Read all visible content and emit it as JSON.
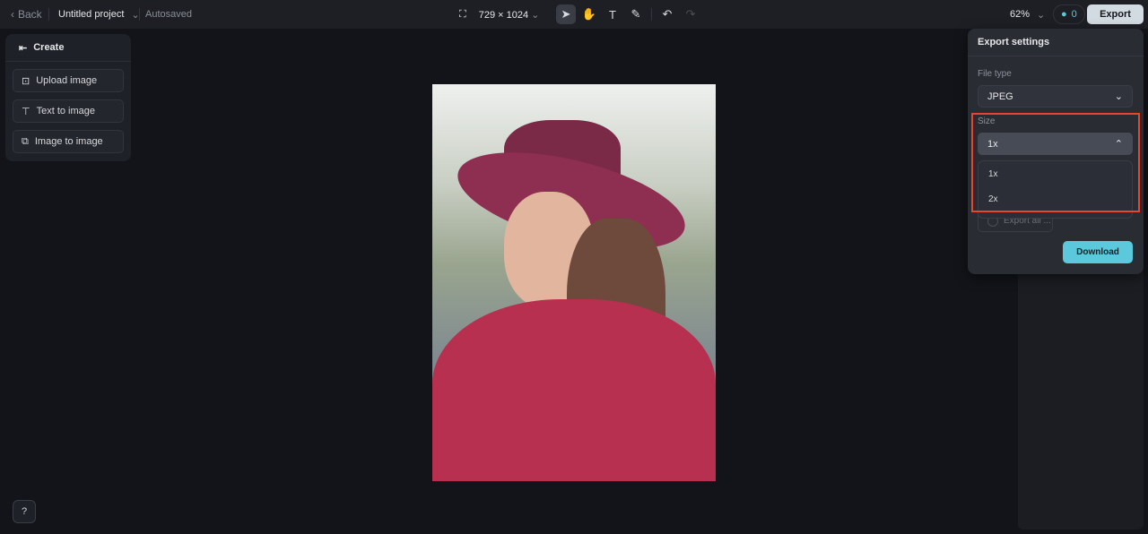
{
  "topbar": {
    "back": "Back",
    "project": "Untitled project",
    "status": "Autosaved",
    "dimensions": "729 × 1024",
    "zoom": "62%",
    "credits": "0",
    "export": "Export"
  },
  "create": {
    "title": "Create",
    "items": [
      {
        "label": "Upload image",
        "icon": "upload-image-icon"
      },
      {
        "label": "Text to image",
        "icon": "text-to-image-icon"
      },
      {
        "label": "Image to image",
        "icon": "image-to-image-icon"
      }
    ]
  },
  "export_panel": {
    "title": "Export settings",
    "file_type_label": "File type",
    "file_type": "JPEG",
    "size_label": "Size",
    "size": "1x",
    "size_options": [
      "1x",
      "2x"
    ],
    "export_all": "Export all ...",
    "download": "Download"
  },
  "colors": {
    "accent": "#5bc8dc",
    "highlight": "#e8442e"
  }
}
